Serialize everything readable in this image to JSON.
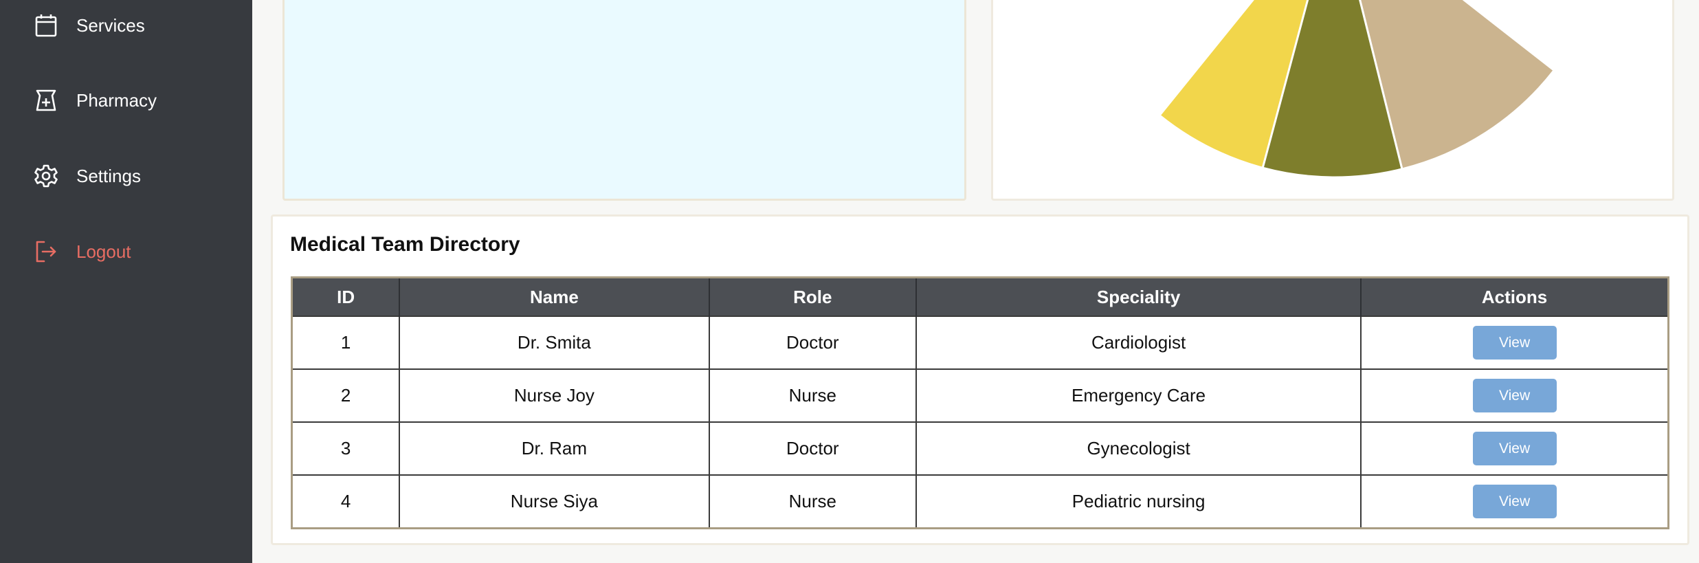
{
  "sidebar": {
    "items": [
      {
        "label": "Services",
        "icon": "calendar-icon"
      },
      {
        "label": "Pharmacy",
        "icon": "pharmacy-icon"
      },
      {
        "label": "Settings",
        "icon": "gear-icon"
      },
      {
        "label": "Logout",
        "icon": "logout-icon"
      }
    ]
  },
  "chart_data": {
    "type": "pie",
    "note_visible": "partial pie, only lower portion visible",
    "slices": [
      {
        "color": "#f2d64b"
      },
      {
        "color": "#7e7e2c"
      },
      {
        "color": "#cbb48f"
      }
    ]
  },
  "directory": {
    "title": "Medical Team Directory",
    "columns": [
      "ID",
      "Name",
      "Role",
      "Speciality",
      "Actions"
    ],
    "rows": [
      {
        "id": "1",
        "name": "Dr. Smita",
        "role": "Doctor",
        "speciality": "Cardiologist",
        "action": "View"
      },
      {
        "id": "2",
        "name": "Nurse Joy",
        "role": "Nurse",
        "speciality": "Emergency Care",
        "action": "View"
      },
      {
        "id": "3",
        "name": "Dr. Ram",
        "role": "Doctor",
        "speciality": "Gynecologist",
        "action": "View"
      },
      {
        "id": "4",
        "name": "Nurse Siya",
        "role": "Nurse",
        "speciality": "Pediatric nursing",
        "action": "View"
      }
    ]
  },
  "colors": {
    "sidebar_bg": "#373a3f",
    "logout": "#e76d63",
    "table_header": "#4c4f54",
    "view_button": "#78a7d8"
  }
}
